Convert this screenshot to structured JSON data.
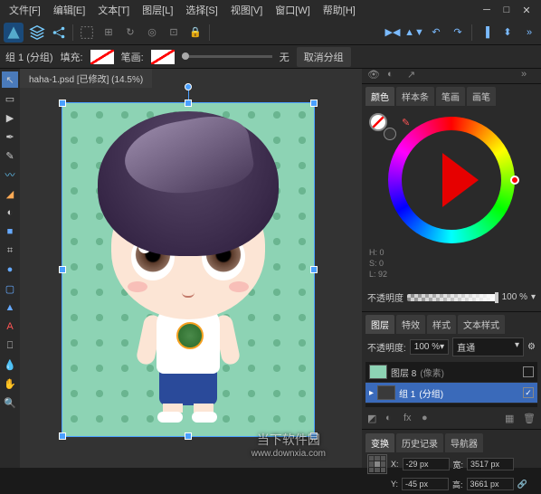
{
  "menu": [
    "文件[F]",
    "编辑[E]",
    "文本[T]",
    "图层[L]",
    "选择[S]",
    "视图[V]",
    "窗口[W]",
    "帮助[H]"
  ],
  "context": {
    "group_label": "组 1 (分组)",
    "fill_label": "填充:",
    "stroke_label": "笔画:",
    "none_label": "无",
    "cancel_group": "取消分组"
  },
  "tab_title": "haha-1.psd [已修改] (14.5%)",
  "color_panel": {
    "tabs": [
      "颜色",
      "样本条",
      "笔画",
      "画笔"
    ],
    "hsl": {
      "h": "H: 0",
      "s": "S: 0",
      "l": "L: 92"
    },
    "opacity_label": "不透明度",
    "opacity_value": "100 %"
  },
  "layers_panel": {
    "tabs": [
      "图层",
      "特效",
      "样式",
      "文本样式"
    ],
    "opacity_label": "不透明度:",
    "opacity_value": "100 %",
    "blend_value": "直通",
    "items": [
      {
        "name": "图层 8",
        "suffix": "(像素)",
        "selected": false
      },
      {
        "name": "组 1",
        "suffix": "(分组)",
        "selected": true
      }
    ]
  },
  "transform_panel": {
    "tabs": [
      "变换",
      "历史记录",
      "导航器"
    ],
    "x_label": "X:",
    "x_val": "-29 px",
    "y_label": "Y:",
    "y_val": "-45 px",
    "w_label": "宽:",
    "w_val": "3517 px",
    "h_label": "高:",
    "h_val": "3661 px"
  },
  "watermark": {
    "name": "当下软件园",
    "url": "www.downxia.com"
  }
}
